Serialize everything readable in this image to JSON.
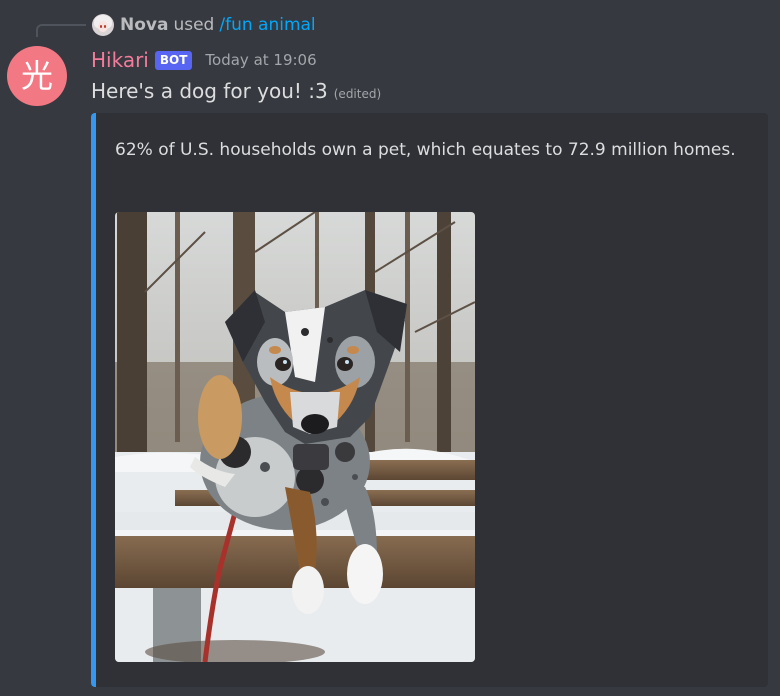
{
  "reply": {
    "user": "Nova",
    "action": "used",
    "command": "/fun animal"
  },
  "message": {
    "avatar_glyph": "光",
    "username": "Hikari",
    "bot_tag": "BOT",
    "timestamp": "Today at 19:06",
    "content": "Here's a dog for you! :3",
    "edited_label": "(edited)"
  },
  "embed": {
    "description": "62% of U.S. households own a pet, which equates to 72.9 million homes.",
    "accent_color": "#3498f0",
    "image_subject": "dog-photo"
  },
  "colors": {
    "background": "#36393f",
    "embed_background": "#2f3136",
    "username": "#f47b9b",
    "bot_tag": "#5865f2",
    "command_link": "#00a8fc",
    "avatar": "#f27884"
  }
}
